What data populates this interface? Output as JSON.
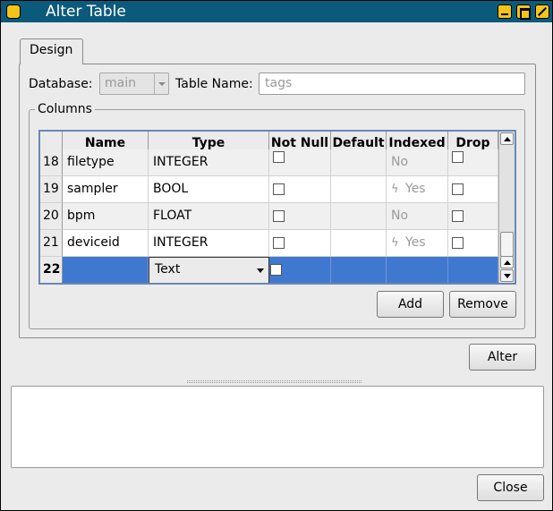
{
  "window": {
    "title": "Alter Table"
  },
  "tabs": [
    {
      "label": "Design"
    }
  ],
  "form": {
    "database_label": "Database:",
    "database_value": "main",
    "table_name_label": "Table Name:",
    "table_name_placeholder": "tags"
  },
  "columns_group": {
    "title": "Columns",
    "headers": [
      "Name",
      "Type",
      "Not Null",
      "Default",
      "Indexed",
      "Drop"
    ],
    "rows": [
      {
        "num": "18",
        "name": "filetype",
        "type": "INTEGER",
        "indexed": "No",
        "indexed_icon": ""
      },
      {
        "num": "19",
        "name": "sampler",
        "type": "BOOL",
        "indexed": "Yes",
        "indexed_icon": "lightning-icon"
      },
      {
        "num": "20",
        "name": "bpm",
        "type": "FLOAT",
        "indexed": "No",
        "indexed_icon": ""
      },
      {
        "num": "21",
        "name": "deviceid",
        "type": "INTEGER",
        "indexed": "Yes",
        "indexed_icon": "lightning-icon"
      }
    ],
    "selected_row": {
      "num": "22",
      "name": "",
      "type": "Text"
    },
    "add_label": "Add",
    "remove_label": "Remove"
  },
  "alter_label": "Alter",
  "close_label": "Close",
  "colors": {
    "titlebar": "#0b5a7b",
    "window_buttons": "#f4c418",
    "selection": "#3f78cf"
  }
}
